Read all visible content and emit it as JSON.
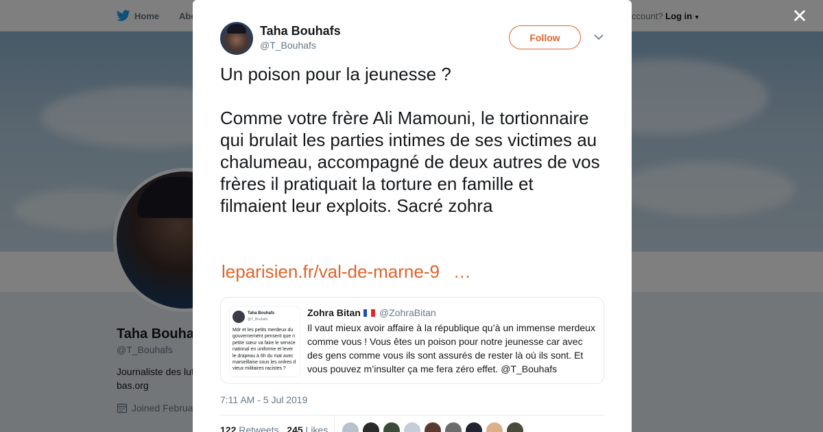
{
  "background": {
    "nav": {
      "home_label": "Home",
      "about_label": "Abo",
      "account_prompt": "ccount?",
      "login_label": "Log in"
    },
    "profile": {
      "name": "Taha Bouha",
      "handle": "@T_Bouhafs",
      "bio_line1": "Journaliste des lut",
      "bio_line2": "bas.org",
      "joined": "Joined Februa"
    }
  },
  "modal": {
    "author": {
      "name": "Taha Bouhafs",
      "handle": "@T_Bouhafs"
    },
    "follow_label": "Follow",
    "tweet_text": "Un poison pour la jeunesse ?\n\nComme votre frère Ali Mamouni, le tortionnaire qui brulait les parties intimes de ses victimes au chalumeau, accompagné de deux autres de vos frères il pratiquait la torture en famille et filmaient leur exploits. Sacré zohra",
    "link_text": "leparisien.fr/val-de-marne-9",
    "link_ellipsis": "…",
    "quote": {
      "name": "Zohra Bitan",
      "handle": "@ZohraBitan",
      "text": "Il vaut mieux avoir affaire à la république qu’à un immense merdeux comme vous ! Vous êtes un poison pour notre jeunesse car avec des gens comme vous ils sont assurés de rester là où ils sont. Et vous pouvez m’insulter ça me fera zéro effet. @T_Bouhafs",
      "thumb": {
        "name": "Taha Bouhafs",
        "handle": "@T_Bouhafs",
        "text": "Mdr et les petits merdeux du\ngouvernement pensent que n\npetite sœur va faire le service\nnational en uniforme et lever\nle drapeau à 6h du mat avec\nmarseillaise sous les ordres d\nvieux militaires racistes ?"
      }
    },
    "timestamp": "7:11 AM - 5 Jul 2019",
    "stats": {
      "retweets_count": "122",
      "retweets_label": "Retweets",
      "likes_count": "245",
      "likes_label": "Likes"
    },
    "liker_colors": [
      "#b8c2cc",
      "#2a2a2a",
      "#3c4a3a",
      "#c5ced8",
      "#5a3a30",
      "#6b6b6b",
      "#222233",
      "#d9b08a",
      "#4a4a3a"
    ]
  },
  "colors": {
    "accent": "#e0632b",
    "twitter_blue": "#1da1f2"
  },
  "icons": [
    "twitter-bird-icon",
    "close-icon",
    "chevron-down-icon",
    "calendar-icon",
    "caret-down-icon"
  ]
}
